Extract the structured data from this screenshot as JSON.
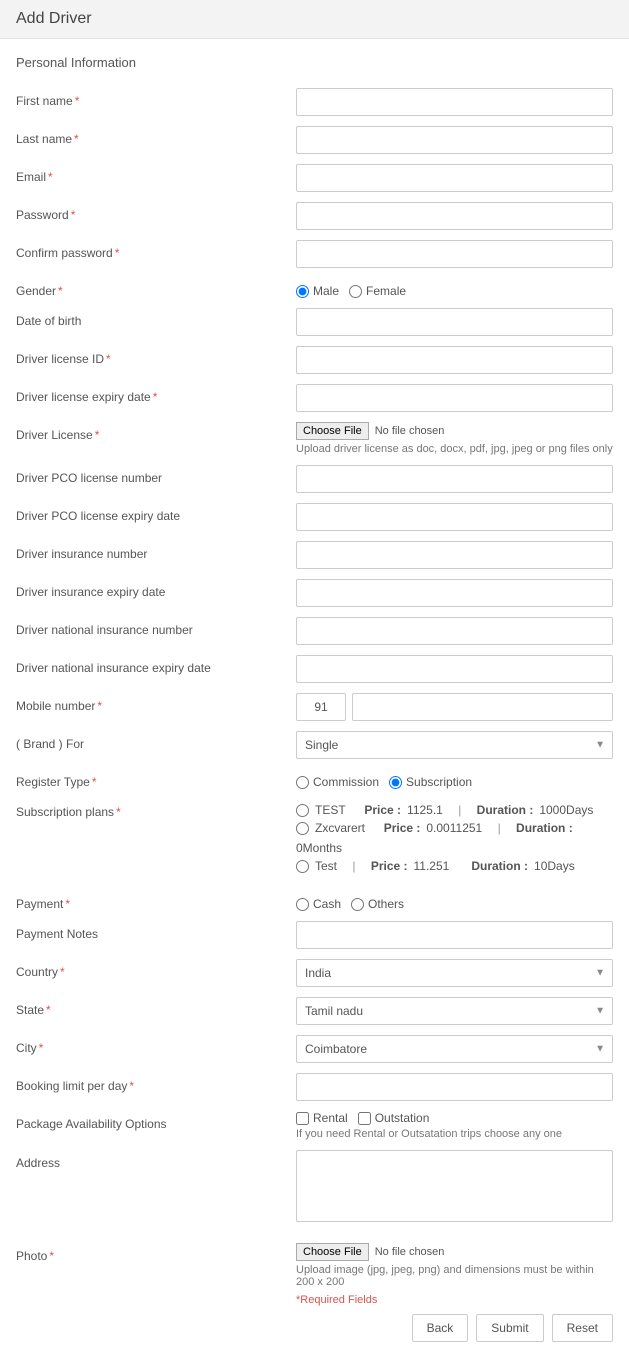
{
  "header": {
    "title": "Add Driver"
  },
  "section": {
    "title": "Personal Information"
  },
  "labels": {
    "first_name": "First name",
    "last_name": "Last name",
    "email": "Email",
    "password": "Password",
    "confirm_password": "Confirm password",
    "gender": "Gender",
    "dob": "Date of birth",
    "license_id": "Driver license ID",
    "license_expiry": "Driver license expiry date",
    "driver_license": "Driver License",
    "pco_number": "Driver PCO license number",
    "pco_expiry": "Driver PCO license expiry date",
    "insurance_number": "Driver insurance number",
    "insurance_expiry": "Driver insurance expiry date",
    "national_insurance_number": "Driver national insurance number",
    "national_insurance_expiry": "Driver national insurance expiry date",
    "mobile_number": "Mobile number",
    "brand_for": "( Brand ) For",
    "register_type": "Register Type",
    "subscription_plans": "Subscription plans",
    "payment": "Payment",
    "payment_notes": "Payment Notes",
    "country": "Country",
    "state": "State",
    "city": "City",
    "booking_limit": "Booking limit per day",
    "package_availability": "Package Availability Options",
    "address": "Address",
    "photo": "Photo"
  },
  "gender": {
    "male": "Male",
    "female": "Female"
  },
  "file": {
    "choose": "Choose File",
    "none": "No file chosen"
  },
  "hints": {
    "license": "Upload driver license as doc, docx, pdf, jpg, jpeg or png files only",
    "package": "If you need Rental or Outsatation trips choose any one",
    "photo": "Upload image (jpg, jpeg, png) and dimensions must be within 200 x 200",
    "required": "*Required Fields"
  },
  "mobile": {
    "prefix": "91"
  },
  "brand_for": {
    "selected": "Single"
  },
  "register_type": {
    "commission": "Commission",
    "subscription": "Subscription"
  },
  "plans": [
    {
      "name": "TEST",
      "price_label": "Price :",
      "price": "1125.1",
      "duration_label": "Duration :",
      "duration": "1000Days"
    },
    {
      "name": "Zxcvarert",
      "price_label": "Price :",
      "price": "0.0011251",
      "duration_label": "Duration :",
      "duration": "0Months"
    },
    {
      "name": "Test",
      "price_label": "Price :",
      "price": "11.251",
      "duration_label": "Duration :",
      "duration": "10Days"
    }
  ],
  "payment": {
    "cash": "Cash",
    "others": "Others"
  },
  "country": {
    "selected": "India"
  },
  "state": {
    "selected": "Tamil nadu"
  },
  "city": {
    "selected": "Coimbatore"
  },
  "package": {
    "rental": "Rental",
    "outstation": "Outstation"
  },
  "buttons": {
    "back": "Back",
    "submit": "Submit",
    "reset": "Reset"
  },
  "sep": "|"
}
